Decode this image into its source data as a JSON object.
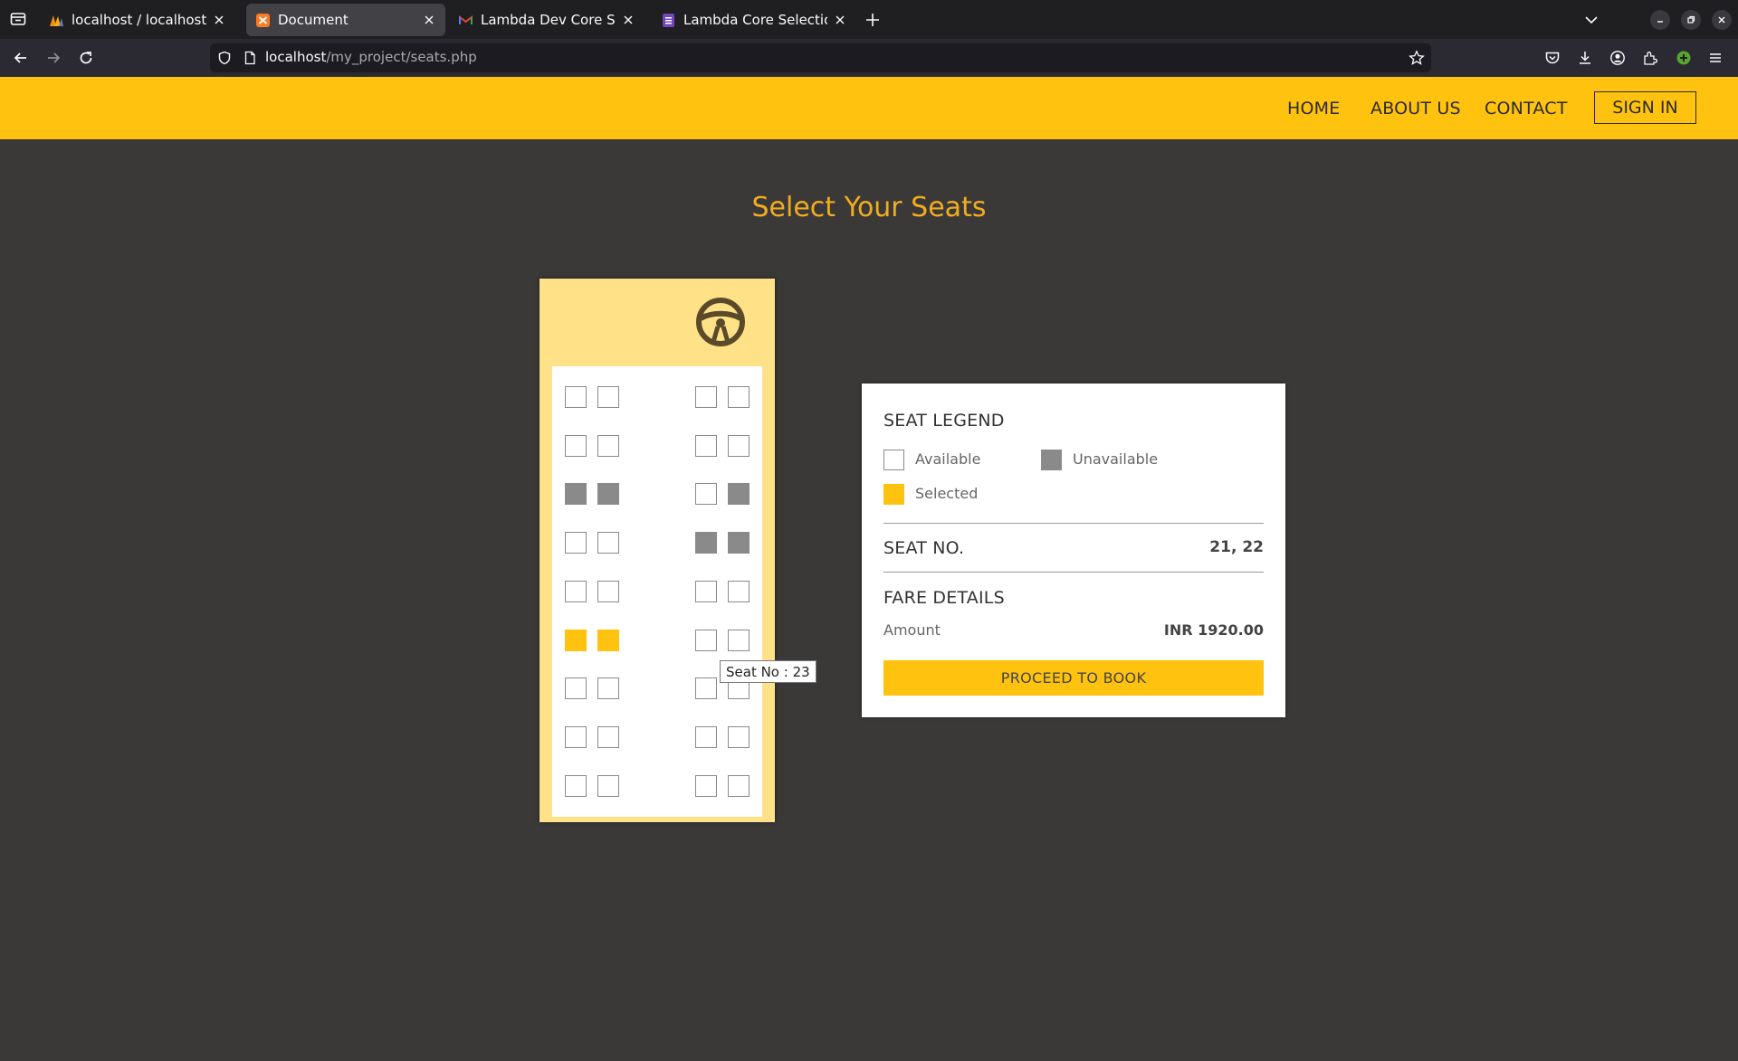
{
  "browser": {
    "tabs": [
      {
        "title": "localhost / localhost / bu",
        "active": false,
        "favicon": "phpmyadmin-icon"
      },
      {
        "title": "Document",
        "active": true,
        "favicon": "xampp-icon"
      },
      {
        "title": "Lambda Dev Core Selecti",
        "active": false,
        "favicon": "gmail-icon"
      },
      {
        "title": "Lambda Core Selection",
        "active": false,
        "favicon": "forms-icon"
      }
    ],
    "url_host": "localhost",
    "url_path": "/my_project/seats.php"
  },
  "site": {
    "menu": {
      "home": "HOME",
      "about": "ABOUT US",
      "contact": "CONTACT",
      "signin": "SIGN IN"
    },
    "title": "Select Your Seats"
  },
  "seat_map": {
    "rows": [
      [
        "available",
        "available",
        "available",
        "available"
      ],
      [
        "available",
        "available",
        "available",
        "available"
      ],
      [
        "unavailable",
        "unavailable",
        "available",
        "unavailable"
      ],
      [
        "available",
        "available",
        "unavailable",
        "unavailable"
      ],
      [
        "available",
        "available",
        "available",
        "available"
      ],
      [
        "selected",
        "selected",
        "available",
        "available"
      ],
      [
        "available",
        "available",
        "available",
        "available"
      ],
      [
        "available",
        "available",
        "available",
        "available"
      ],
      [
        "available",
        "available",
        "available",
        "available"
      ]
    ],
    "tooltip": "Seat No : 23"
  },
  "panel": {
    "legend_title": "SEAT LEGEND",
    "legend": {
      "available": "Available",
      "unavailable": "Unavailable",
      "selected": "Selected"
    },
    "seat_no_label": "SEAT NO.",
    "seat_no_value": "21, 22",
    "fare_title": "FARE DETAILS",
    "amount_label": "Amount",
    "amount_value": "INR 1920.00",
    "proceed_label": "PROCEED TO BOOK"
  },
  "colors": {
    "accent": "#ffc20e",
    "title": "#f2ad1e",
    "background": "#3a3938",
    "unavailable": "#8a8a8a",
    "bus_body": "#ffe287"
  }
}
